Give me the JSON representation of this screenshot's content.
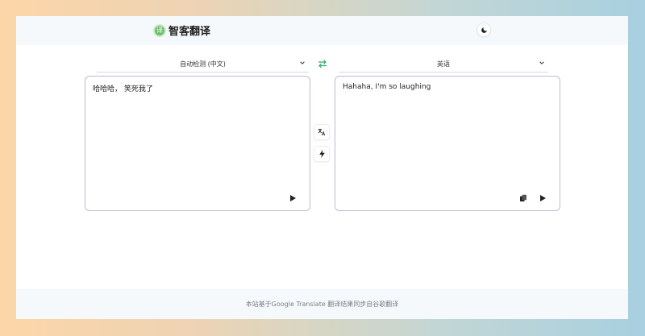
{
  "header": {
    "logo_glyph": "译",
    "site_name": "智客翻译",
    "theme_icon": "moon-icon"
  },
  "source": {
    "language": "自动检测 (中文)",
    "text": "哈哈哈， 笑死我了"
  },
  "target": {
    "language": "英语",
    "text": "Hahaha, I'm so laughing"
  },
  "icons": {
    "swap": "swap-arrows-icon",
    "translate": "translate-icon",
    "bolt": "lightning-icon",
    "play": "play-icon",
    "copy": "copy-icon",
    "chevron": "chevron-down-icon"
  },
  "colors": {
    "accent_green": "#2fa86b",
    "panel_border": "#b9bcd8"
  },
  "footer": {
    "text": "本站基于Google Translate 翻译结果同步自谷歌翻译"
  }
}
